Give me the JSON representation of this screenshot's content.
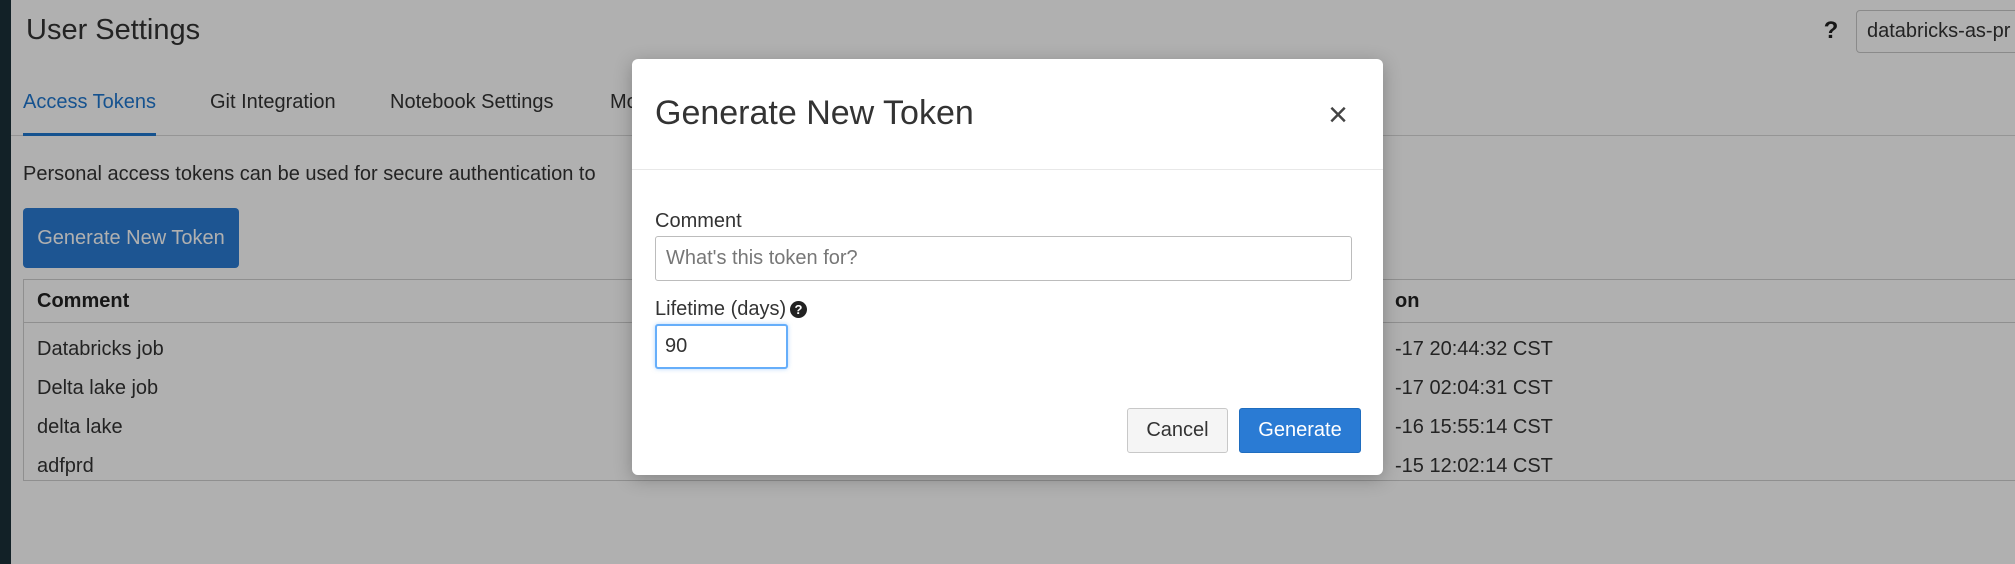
{
  "page": {
    "title": "User Settings",
    "help_icon": "?",
    "workspace": "databricks-as-pr"
  },
  "tabs": [
    {
      "label": "Access Tokens",
      "active": true
    },
    {
      "label": "Git Integration",
      "active": false
    },
    {
      "label": "Notebook Settings",
      "active": false
    },
    {
      "label": "Mo",
      "active": false
    }
  ],
  "content": {
    "description": "Personal access tokens can be used for secure authentication to",
    "generate_button": "Generate New Token"
  },
  "table": {
    "headers": [
      "Comment",
      "on"
    ],
    "rows": [
      {
        "comment": "Databricks job",
        "date": "-17 20:44:32 CST"
      },
      {
        "comment": "Delta lake job",
        "date": "-17 02:04:31 CST"
      },
      {
        "comment": "delta lake",
        "date": "-16 15:55:14 CST"
      },
      {
        "comment": "adfprd",
        "date": "-15 12:02:14 CST"
      }
    ]
  },
  "modal": {
    "title": "Generate New Token",
    "close_icon": "×",
    "comment_label": "Comment",
    "comment_placeholder": "What's this token for?",
    "comment_value": "",
    "lifetime_label": "Lifetime (days)",
    "lifetime_info_icon": "?",
    "lifetime_value": "90",
    "cancel_label": "Cancel",
    "generate_label": "Generate"
  },
  "colors": {
    "accent": "#2a7bd4",
    "active_tab": "#1f77d0",
    "sidebar": "#1b3139",
    "overlay": "rgba(0,0,0,0.31)"
  },
  "icons": {
    "help": "help-icon",
    "close": "close-icon",
    "info": "info-icon"
  }
}
